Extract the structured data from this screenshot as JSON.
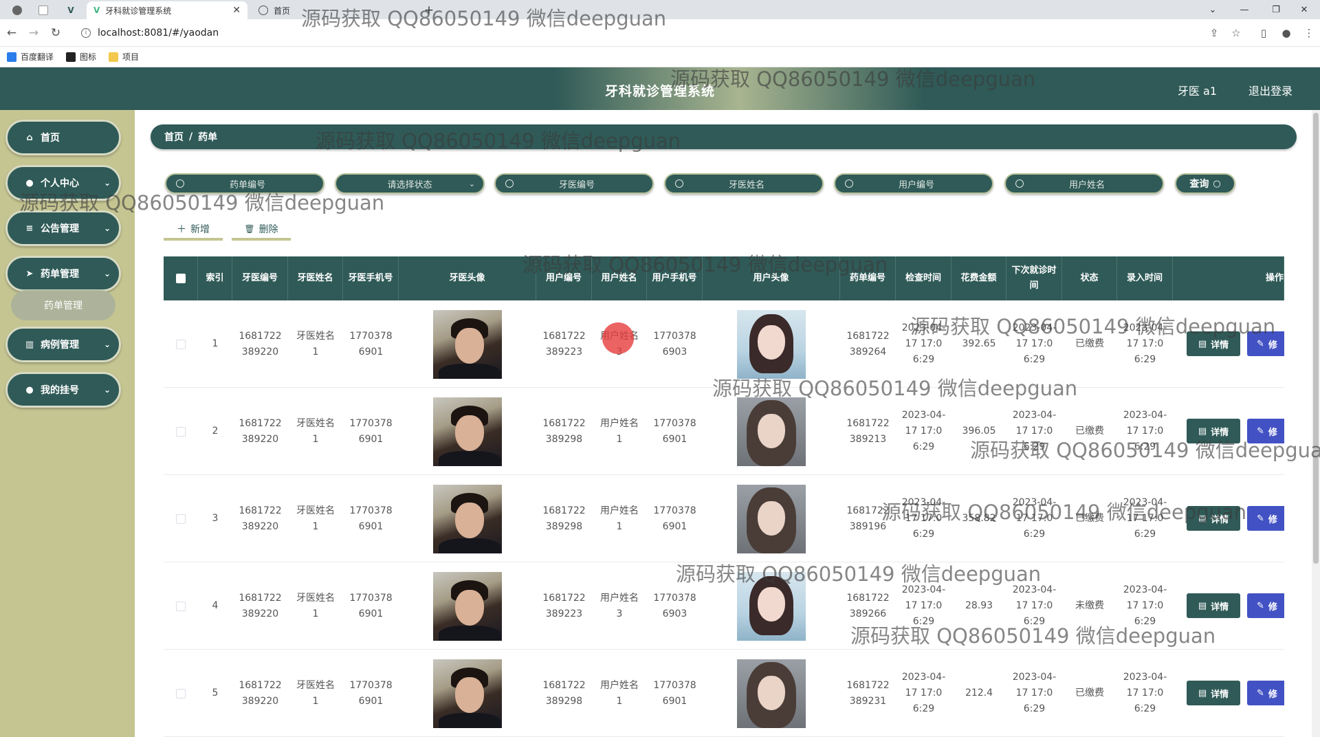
{
  "browser": {
    "tabs": [
      {
        "label": "牙科就诊管理系统",
        "active": true
      },
      {
        "label": "首页",
        "active": false
      }
    ],
    "url": "localhost:8081/#/yaodan",
    "bookmarks": [
      "百度翻译",
      "图标",
      "项目"
    ]
  },
  "header": {
    "title": "牙科就诊管理系统",
    "user": "牙医 a1",
    "logout": "退出登录"
  },
  "sidebar": {
    "items": [
      {
        "label": "首页",
        "icon": "home-icon",
        "has_arrow": false
      },
      {
        "label": "个人中心",
        "icon": "user-icon",
        "has_arrow": true
      },
      {
        "label": "公告管理",
        "icon": "list-icon",
        "has_arrow": true
      },
      {
        "label": "药单管理",
        "icon": "send-icon",
        "has_arrow": true
      },
      {
        "label": "病例管理",
        "icon": "chart-icon",
        "has_arrow": true
      },
      {
        "label": "我的挂号",
        "icon": "location-icon",
        "has_arrow": true
      }
    ],
    "submenu": "药单管理"
  },
  "breadcrumb": {
    "home": "首页",
    "separator": "/",
    "current": "药单"
  },
  "search": {
    "fields": [
      {
        "placeholder": "药单编号",
        "type": "input"
      },
      {
        "placeholder": "请选择状态",
        "type": "select"
      },
      {
        "placeholder": "牙医编号",
        "type": "input"
      },
      {
        "placeholder": "牙医姓名",
        "type": "input"
      },
      {
        "placeholder": "用户编号",
        "type": "input"
      },
      {
        "placeholder": "用户姓名",
        "type": "input"
      }
    ],
    "query_label": "查询"
  },
  "actions": {
    "add": "新增",
    "delete": "删除"
  },
  "table": {
    "headers": [
      "",
      "索引",
      "牙医编号",
      "牙医姓名",
      "牙医手机号",
      "牙医头像",
      "用户编号",
      "用户姓名",
      "用户手机号",
      "用户头像",
      "药单编号",
      "检查时间",
      "花费金额",
      "下次就诊时间",
      "状态",
      "录入时间",
      "操作"
    ],
    "detail_label": "详情",
    "edit_label": "修",
    "rows": [
      {
        "index": "1",
        "dentist_no": "1681722389220",
        "dentist_name": "牙医姓名1",
        "dentist_phone": "17703786901",
        "user_no": "1681722389223",
        "user_name": "用户姓名3",
        "user_phone": "17703786903",
        "user_avatar": "user1",
        "order_no": "1681722389264",
        "check_time": "2023-04-17 17:06:29",
        "amount": "392.65",
        "next_visit": "2023-04-17 17:06:29",
        "status": "已缴费",
        "created": "2023-04-17 17:06:29"
      },
      {
        "index": "2",
        "dentist_no": "1681722389220",
        "dentist_name": "牙医姓名1",
        "dentist_phone": "17703786901",
        "user_no": "1681722389298",
        "user_name": "用户姓名1",
        "user_phone": "17703786901",
        "user_avatar": "user2",
        "order_no": "1681722389213",
        "check_time": "2023-04-17 17:06:29",
        "amount": "396.05",
        "next_visit": "2023-04-17 17:06:29",
        "status": "已缴费",
        "created": "2023-04-17 17:06:29"
      },
      {
        "index": "3",
        "dentist_no": "1681722389220",
        "dentist_name": "牙医姓名1",
        "dentist_phone": "17703786901",
        "user_no": "1681722389298",
        "user_name": "用户姓名1",
        "user_phone": "17703786901",
        "user_avatar": "user2",
        "order_no": "1681722389196",
        "check_time": "2023-04-17 17:06:29",
        "amount": "358.82",
        "next_visit": "2023-04-17 17:06:29",
        "status": "已缴费",
        "created": "2023-04-17 17:06:29"
      },
      {
        "index": "4",
        "dentist_no": "1681722389220",
        "dentist_name": "牙医姓名1",
        "dentist_phone": "17703786901",
        "user_no": "1681722389223",
        "user_name": "用户姓名3",
        "user_phone": "17703786903",
        "user_avatar": "user1",
        "order_no": "1681722389266",
        "check_time": "2023-04-17 17:06:29",
        "amount": "28.93",
        "next_visit": "2023-04-17 17:06:29",
        "status": "未缴费",
        "created": "2023-04-17 17:06:29"
      },
      {
        "index": "5",
        "dentist_no": "1681722389220",
        "dentist_name": "牙医姓名1",
        "dentist_phone": "17703786901",
        "user_no": "1681722389298",
        "user_name": "用户姓名1",
        "user_phone": "17703786901",
        "user_avatar": "user2",
        "order_no": "1681722389231",
        "check_time": "2023-04-17 17:06:29",
        "amount": "212.4",
        "next_visit": "2023-04-17 17:06:29",
        "status": "已缴费",
        "created": "2023-04-17 17:06:29"
      }
    ]
  },
  "watermark": "源码获取 QQ86050149 微信deepguan",
  "colors": {
    "primary": "#2f5a57",
    "sidebar": "#c5c592",
    "edit": "#4252c4"
  }
}
